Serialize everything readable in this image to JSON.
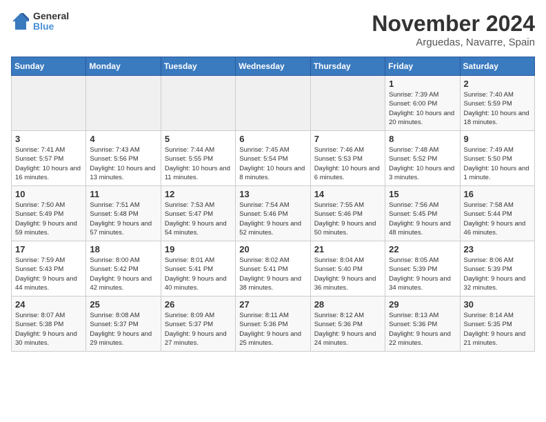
{
  "logo": {
    "general": "General",
    "blue": "Blue"
  },
  "title": "November 2024",
  "location": "Arguedas, Navarre, Spain",
  "headers": [
    "Sunday",
    "Monday",
    "Tuesday",
    "Wednesday",
    "Thursday",
    "Friday",
    "Saturday"
  ],
  "weeks": [
    [
      {
        "day": "",
        "info": ""
      },
      {
        "day": "",
        "info": ""
      },
      {
        "day": "",
        "info": ""
      },
      {
        "day": "",
        "info": ""
      },
      {
        "day": "",
        "info": ""
      },
      {
        "day": "1",
        "info": "Sunrise: 7:39 AM\nSunset: 6:00 PM\nDaylight: 10 hours and 20 minutes."
      },
      {
        "day": "2",
        "info": "Sunrise: 7:40 AM\nSunset: 5:59 PM\nDaylight: 10 hours and 18 minutes."
      }
    ],
    [
      {
        "day": "3",
        "info": "Sunrise: 7:41 AM\nSunset: 5:57 PM\nDaylight: 10 hours and 16 minutes."
      },
      {
        "day": "4",
        "info": "Sunrise: 7:43 AM\nSunset: 5:56 PM\nDaylight: 10 hours and 13 minutes."
      },
      {
        "day": "5",
        "info": "Sunrise: 7:44 AM\nSunset: 5:55 PM\nDaylight: 10 hours and 11 minutes."
      },
      {
        "day": "6",
        "info": "Sunrise: 7:45 AM\nSunset: 5:54 PM\nDaylight: 10 hours and 8 minutes."
      },
      {
        "day": "7",
        "info": "Sunrise: 7:46 AM\nSunset: 5:53 PM\nDaylight: 10 hours and 6 minutes."
      },
      {
        "day": "8",
        "info": "Sunrise: 7:48 AM\nSunset: 5:52 PM\nDaylight: 10 hours and 3 minutes."
      },
      {
        "day": "9",
        "info": "Sunrise: 7:49 AM\nSunset: 5:50 PM\nDaylight: 10 hours and 1 minute."
      }
    ],
    [
      {
        "day": "10",
        "info": "Sunrise: 7:50 AM\nSunset: 5:49 PM\nDaylight: 9 hours and 59 minutes."
      },
      {
        "day": "11",
        "info": "Sunrise: 7:51 AM\nSunset: 5:48 PM\nDaylight: 9 hours and 57 minutes."
      },
      {
        "day": "12",
        "info": "Sunrise: 7:53 AM\nSunset: 5:47 PM\nDaylight: 9 hours and 54 minutes."
      },
      {
        "day": "13",
        "info": "Sunrise: 7:54 AM\nSunset: 5:46 PM\nDaylight: 9 hours and 52 minutes."
      },
      {
        "day": "14",
        "info": "Sunrise: 7:55 AM\nSunset: 5:46 PM\nDaylight: 9 hours and 50 minutes."
      },
      {
        "day": "15",
        "info": "Sunrise: 7:56 AM\nSunset: 5:45 PM\nDaylight: 9 hours and 48 minutes."
      },
      {
        "day": "16",
        "info": "Sunrise: 7:58 AM\nSunset: 5:44 PM\nDaylight: 9 hours and 46 minutes."
      }
    ],
    [
      {
        "day": "17",
        "info": "Sunrise: 7:59 AM\nSunset: 5:43 PM\nDaylight: 9 hours and 44 minutes."
      },
      {
        "day": "18",
        "info": "Sunrise: 8:00 AM\nSunset: 5:42 PM\nDaylight: 9 hours and 42 minutes."
      },
      {
        "day": "19",
        "info": "Sunrise: 8:01 AM\nSunset: 5:41 PM\nDaylight: 9 hours and 40 minutes."
      },
      {
        "day": "20",
        "info": "Sunrise: 8:02 AM\nSunset: 5:41 PM\nDaylight: 9 hours and 38 minutes."
      },
      {
        "day": "21",
        "info": "Sunrise: 8:04 AM\nSunset: 5:40 PM\nDaylight: 9 hours and 36 minutes."
      },
      {
        "day": "22",
        "info": "Sunrise: 8:05 AM\nSunset: 5:39 PM\nDaylight: 9 hours and 34 minutes."
      },
      {
        "day": "23",
        "info": "Sunrise: 8:06 AM\nSunset: 5:39 PM\nDaylight: 9 hours and 32 minutes."
      }
    ],
    [
      {
        "day": "24",
        "info": "Sunrise: 8:07 AM\nSunset: 5:38 PM\nDaylight: 9 hours and 30 minutes."
      },
      {
        "day": "25",
        "info": "Sunrise: 8:08 AM\nSunset: 5:37 PM\nDaylight: 9 hours and 29 minutes."
      },
      {
        "day": "26",
        "info": "Sunrise: 8:09 AM\nSunset: 5:37 PM\nDaylight: 9 hours and 27 minutes."
      },
      {
        "day": "27",
        "info": "Sunrise: 8:11 AM\nSunset: 5:36 PM\nDaylight: 9 hours and 25 minutes."
      },
      {
        "day": "28",
        "info": "Sunrise: 8:12 AM\nSunset: 5:36 PM\nDaylight: 9 hours and 24 minutes."
      },
      {
        "day": "29",
        "info": "Sunrise: 8:13 AM\nSunset: 5:36 PM\nDaylight: 9 hours and 22 minutes."
      },
      {
        "day": "30",
        "info": "Sunrise: 8:14 AM\nSunset: 5:35 PM\nDaylight: 9 hours and 21 minutes."
      }
    ]
  ]
}
